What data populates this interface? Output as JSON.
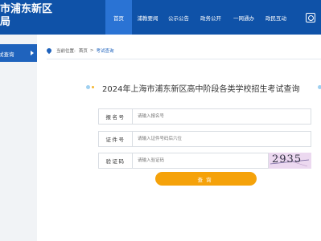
{
  "header": {
    "brand_line1": "市浦东新区",
    "brand_line2": "局",
    "nav": [
      {
        "label": "首页",
        "active": true
      },
      {
        "label": "浦教要闻",
        "active": false
      },
      {
        "label": "公示公告",
        "active": false
      },
      {
        "label": "政务公开",
        "active": false
      },
      {
        "label": "一网通办",
        "active": false
      },
      {
        "label": "政民互动",
        "active": false
      }
    ],
    "nav_icon": "wechat-icon"
  },
  "sidebar": {
    "active_item": "试查询"
  },
  "breadcrumb": {
    "prefix": "当前位置:",
    "home": "首页",
    "separator": ">",
    "current": "考试查询"
  },
  "page": {
    "title": "2024年上海市浦东新区高中阶段各类学校招生考试查询"
  },
  "form": {
    "name_label": "报名号",
    "name_placeholder": "请输入报名号",
    "id_label": "证件号",
    "id_placeholder": "请输入证件号码后六位",
    "code_label": "验证码",
    "code_placeholder": "请输入验证码",
    "captcha_text": "2935",
    "submit_label": "查询"
  },
  "colors": {
    "header_bg": "#0f52a8",
    "nav_active": "#2a73d4",
    "sidebar_active": "#1f63bd",
    "button": "#f5a20a",
    "captcha_bg": "#ecd9f0"
  }
}
